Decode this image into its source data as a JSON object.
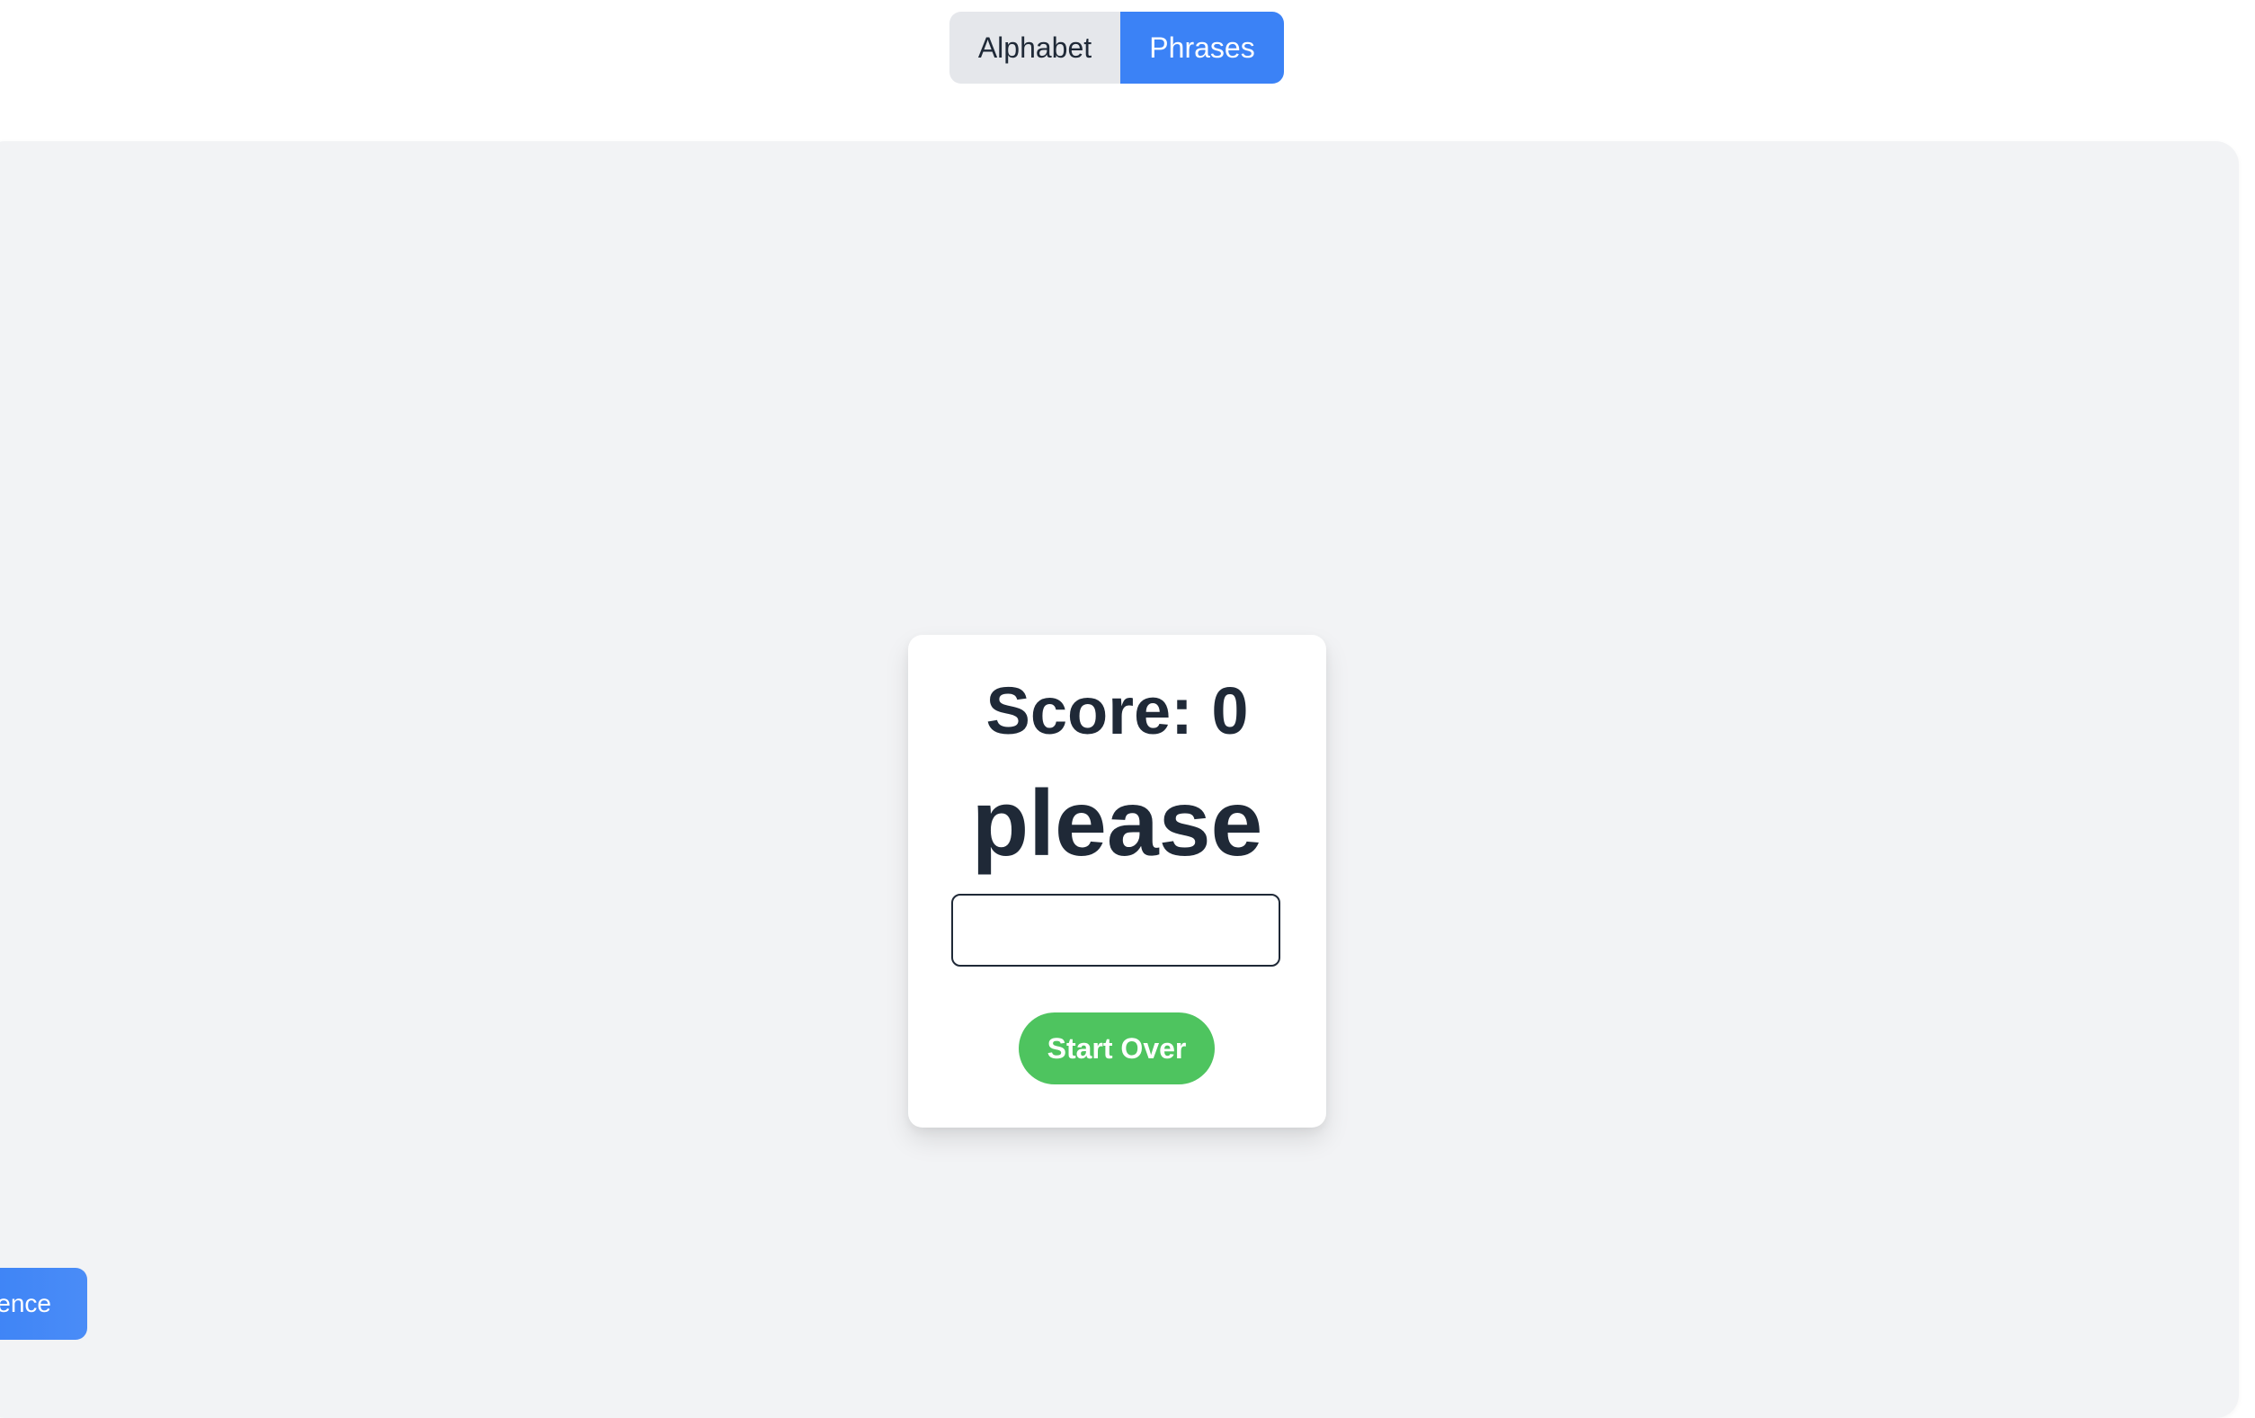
{
  "mode_toggle": {
    "alphabet_label": "Alphabet",
    "phrases_label": "Phrases",
    "active": "Phrases",
    "active_color": "#3b82f6",
    "inactive_color": "#e5e7eb"
  },
  "game": {
    "score_text": "Score: 0",
    "current_phrase": "please",
    "answer_value": "",
    "start_over_label": "Start Over",
    "start_over_color": "#4ec45f"
  },
  "side_button": {
    "label_visible": "ence",
    "color": "#3b82f6"
  }
}
